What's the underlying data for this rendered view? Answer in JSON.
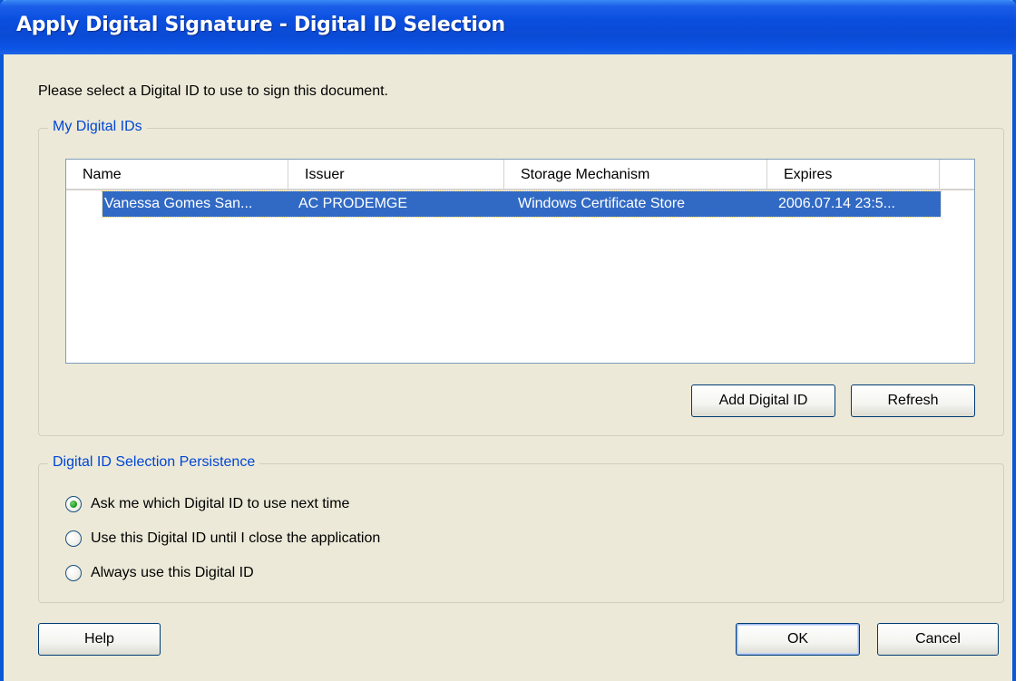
{
  "window": {
    "title": "Apply Digital Signature - Digital ID Selection"
  },
  "prompt": "Please select a Digital ID to use to sign this document.",
  "ids_group": {
    "legend": "My Digital IDs",
    "columns": [
      "Name",
      "Issuer",
      "Storage Mechanism",
      "Expires"
    ],
    "rows": [
      {
        "name": "Vanessa Gomes San...",
        "issuer": "AC PRODEMGE",
        "storage": "Windows Certificate Store",
        "expires": "2006.07.14 23:5..."
      }
    ],
    "add_button": "Add Digital ID",
    "refresh_button": "Refresh"
  },
  "persistence_group": {
    "legend": "Digital ID Selection Persistence",
    "options": [
      {
        "label": "Ask me which Digital ID to use next time",
        "selected": true
      },
      {
        "label": "Use this Digital ID until I close the application",
        "selected": false
      },
      {
        "label": "Always use this Digital ID",
        "selected": false
      }
    ]
  },
  "footer": {
    "help": "Help",
    "ok": "OK",
    "cancel": "Cancel"
  },
  "colors": {
    "title_bar": "#0a4ad4",
    "dialog_bg": "#ece9d8",
    "selection": "#316ac5",
    "group_legend": "#0046d5"
  }
}
